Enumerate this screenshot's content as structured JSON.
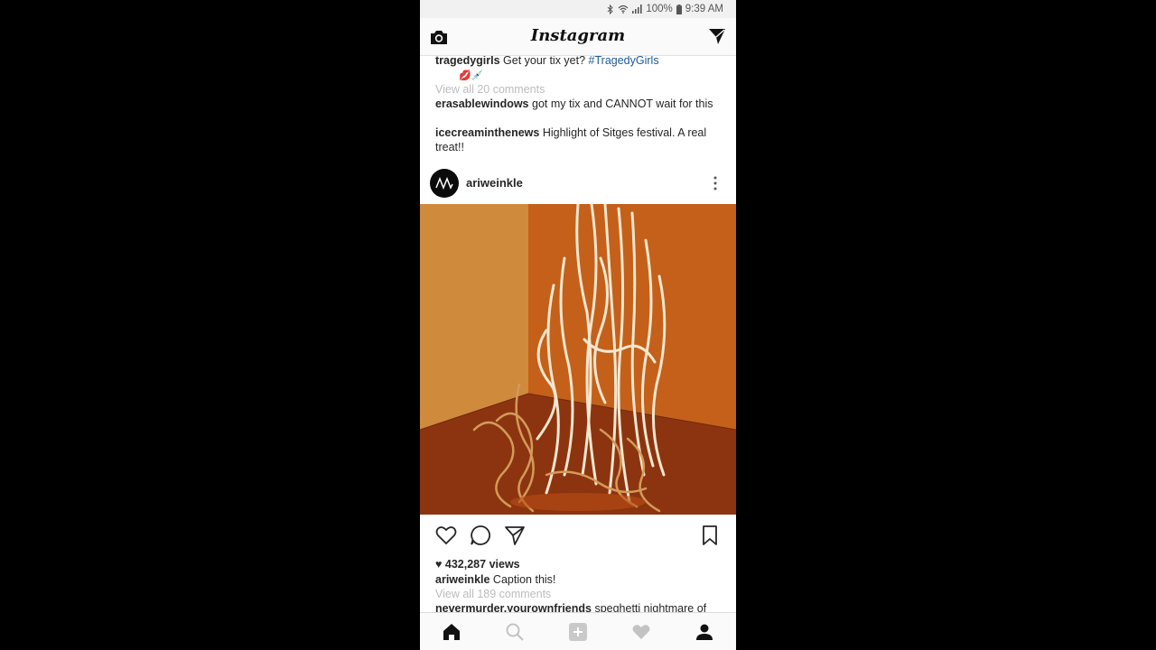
{
  "status": {
    "battery": "100%",
    "time": "9:39 AM"
  },
  "app": {
    "title": "Instagram"
  },
  "prev_post": {
    "caption_user": "tragedygirls",
    "caption_text": " Get your tix yet? ",
    "caption_tag": "#TragedyGirls",
    "caption_emoji": "💋💉",
    "view_comments": "View all 20 comments",
    "comments": [
      {
        "user": "erasablewindows",
        "text": " got my tix and CANNOT wait for this"
      },
      {
        "user": "icecreaminthenews",
        "text": " Highlight of Sitges festival. A real treat!!"
      }
    ]
  },
  "post": {
    "username": "ariweinkle",
    "views": "432,287 views",
    "caption_user": "ariweinkle",
    "caption_text": " Caption this!",
    "view_comments": "View all 189 comments",
    "comment_user": "nevermurder.yourownfriends",
    "comment_text": " speghetti nightmare of"
  },
  "icons": {
    "camera": "camera-icon",
    "direct": "direct-message-icon",
    "more": "more-options-icon",
    "like": "heart-icon",
    "comment": "comment-icon",
    "share": "share-icon",
    "save": "bookmark-icon",
    "home": "home-icon",
    "search": "search-icon",
    "add": "add-post-icon",
    "activity": "activity-heart-icon",
    "profile": "profile-icon"
  },
  "colors": {
    "hashtag": "#1c5a98",
    "muted": "#bcbcbc",
    "text": "#262626"
  }
}
